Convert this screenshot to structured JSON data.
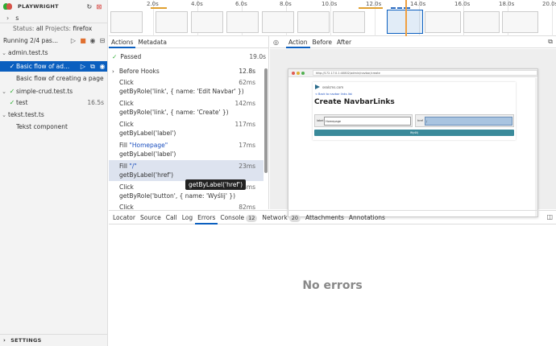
{
  "app": {
    "title": "PLAYWRIGHT"
  },
  "sidebar": {
    "search_value": "s",
    "status_label": "Status:",
    "status_value": "all",
    "projects_label": "Projects:",
    "projects_value": "firefox",
    "running_text": "Running 2/4 pas...",
    "tree": [
      {
        "label": "admin.test.ts",
        "kind": "file",
        "expanded": true
      },
      {
        "label": "Basic flow of ad...",
        "kind": "test",
        "selected": true
      },
      {
        "label": "Basic flow of creating a page",
        "kind": "test"
      },
      {
        "label": "simple-crud.test.ts",
        "kind": "file",
        "expanded": true
      },
      {
        "label": "test",
        "kind": "test",
        "duration": "16.5s"
      },
      {
        "label": "tekst.test.ts",
        "kind": "file",
        "expanded": true
      },
      {
        "label": "Tekst component",
        "kind": "test"
      }
    ],
    "settings_label": "SETTINGS"
  },
  "timeline": {
    "labels": [
      "2.0s",
      "4.0s",
      "6.0s",
      "8.0s",
      "10.0s",
      "12.0s",
      "14.0s",
      "16.0s",
      "18.0s",
      "20.0s"
    ]
  },
  "actions_panel": {
    "tabs": [
      "Actions",
      "Metadata"
    ],
    "passed_label": "Passed",
    "passed_duration": "19.0s",
    "before_hooks_label": "Before Hooks",
    "before_hooks_duration": "12.8s",
    "items": [
      {
        "action": "Click",
        "selector": "getByRole('link', { name: 'Edit Navbar' })",
        "duration": "62ms"
      },
      {
        "action": "Click",
        "selector": "getByRole('link', { name: 'Create' })",
        "duration": "142ms"
      },
      {
        "action": "Click",
        "selector": "getByLabel('label')",
        "duration": "117ms"
      },
      {
        "action": "Fill",
        "value": "\"Homepage\"",
        "selector": "getByLabel('label')",
        "duration": "17ms"
      },
      {
        "action": "Fill",
        "value": "\"/\"",
        "selector": "getByLabel('href')",
        "duration": "23ms",
        "selected": true
      },
      {
        "action": "Click",
        "selector": "getByRole('button', { name: 'Wyślij' })",
        "duration": "58ms"
      },
      {
        "action": "Click",
        "selector": "",
        "duration": "82ms"
      }
    ],
    "tooltip": "getByLabel('href')"
  },
  "snapshot_panel": {
    "tabs": [
      "Action",
      "Before",
      "After"
    ],
    "url": "http://172.17.0.1:40802/admin/navbar/create",
    "page": {
      "logo_text": "sealcms.com",
      "back_link": "< Back to navbar links list",
      "title": "Create NavbarLinks",
      "label_field": {
        "label": "label",
        "value": "Homepage"
      },
      "href_field": {
        "label": "href",
        "value": "/"
      },
      "submit_label": "Wyślij"
    }
  },
  "bottom_panel": {
    "tabs": [
      {
        "label": "Locator"
      },
      {
        "label": "Source"
      },
      {
        "label": "Call"
      },
      {
        "label": "Log"
      },
      {
        "label": "Errors",
        "active": true
      },
      {
        "label": "Console",
        "count": "12"
      },
      {
        "label": "Network",
        "count": "20"
      },
      {
        "label": "Attachments"
      },
      {
        "label": "Annotations"
      }
    ],
    "empty_message": "No errors"
  },
  "colors": {
    "accent": "#0b5fbf",
    "passed": "#2ead33",
    "selected_row": "#0b5fbf"
  }
}
